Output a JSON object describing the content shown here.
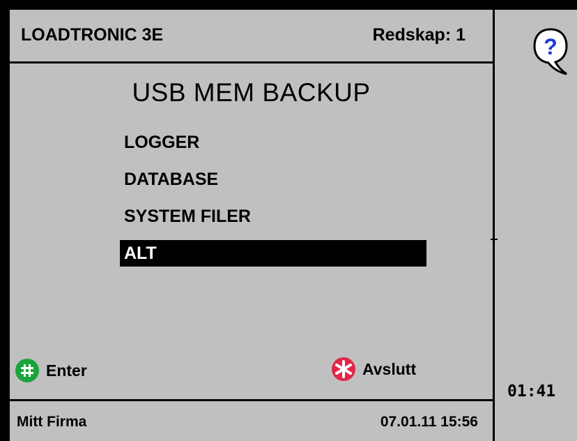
{
  "header": {
    "title": "LOADTRONIC 3E",
    "tool": "Redskap: 1"
  },
  "main": {
    "title": "USB MEM BACKUP",
    "items": [
      {
        "label": "LOGGER"
      },
      {
        "label": "DATABASE"
      },
      {
        "label": "SYSTEM FILER"
      },
      {
        "label": "ALT",
        "selected": true
      }
    ]
  },
  "buttons": {
    "enter": {
      "label": "Enter",
      "icon": "hash-icon",
      "color": "#1aa33a"
    },
    "exit": {
      "label": "Avslutt",
      "icon": "asterisk-icon",
      "color": "#e0284a"
    }
  },
  "help": {
    "icon": "question-icon",
    "color": "#1e3ad8"
  },
  "side": {
    "time": "01:41"
  },
  "footer": {
    "company": "Mitt Firma",
    "datetime": "07.01.11 15:56"
  }
}
